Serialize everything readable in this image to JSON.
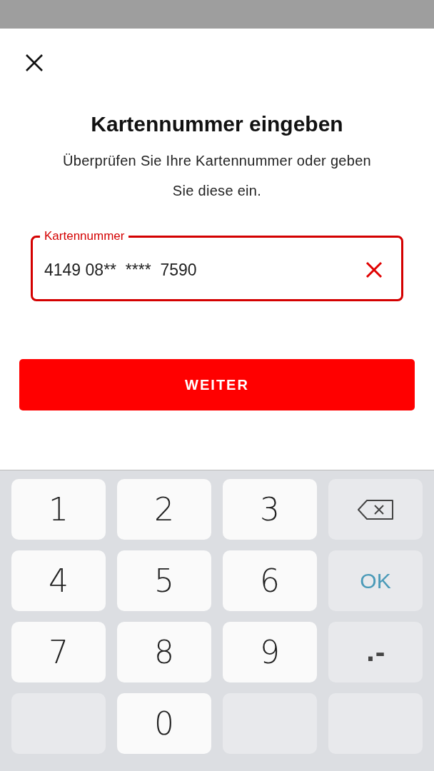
{
  "title": "Kartennummer eingeben",
  "subtitle": "Überprüfen Sie Ihre Kartennummer oder geben Sie diese ein.",
  "card_field": {
    "label": "Kartennummer",
    "value": "4149 08**  ****  7590"
  },
  "continue_button": "WEITER",
  "keyboard": [
    {
      "kind": "digit",
      "label": "1"
    },
    {
      "kind": "digit",
      "label": "2"
    },
    {
      "kind": "digit",
      "label": "3"
    },
    {
      "kind": "backspace"
    },
    {
      "kind": "digit",
      "label": "4"
    },
    {
      "kind": "digit",
      "label": "5"
    },
    {
      "kind": "digit",
      "label": "6"
    },
    {
      "kind": "ok",
      "label": "OK"
    },
    {
      "kind": "digit",
      "label": "7"
    },
    {
      "kind": "digit",
      "label": "8"
    },
    {
      "kind": "digit",
      "label": "9"
    },
    {
      "kind": "symbol",
      "label": ".-"
    },
    {
      "kind": "blank"
    },
    {
      "kind": "digit",
      "label": "0"
    },
    {
      "kind": "blank"
    },
    {
      "kind": "blank"
    }
  ]
}
